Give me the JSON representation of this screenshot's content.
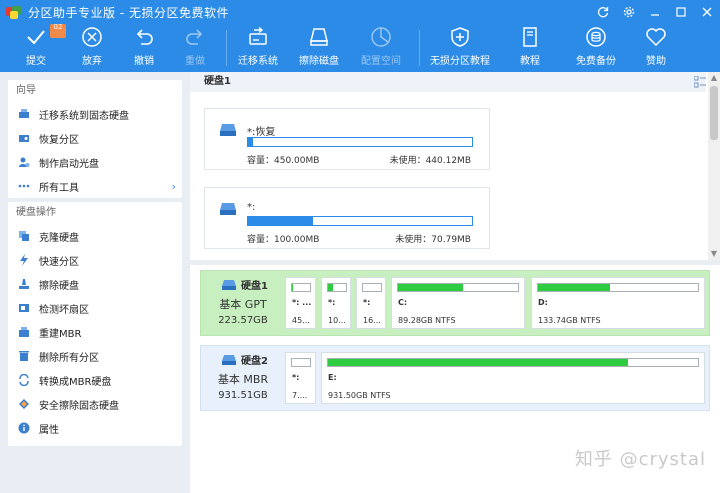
{
  "window": {
    "title": "分区助手专业版 - 无损分区免费软件"
  },
  "toolbar": {
    "submit": "提交",
    "submit_badge": "02",
    "discard": "放弃",
    "undo": "撤销",
    "redo": "重做",
    "migrate": "迁移系统",
    "wipe": "擦除磁盘",
    "alloc": "配置空间",
    "tutorial_lossless": "无损分区教程",
    "tutorial": "教程",
    "backup": "免费备份",
    "donate": "赞助"
  },
  "sidebar": {
    "wizard_title": "向导",
    "wizard_items": [
      {
        "label": "迁移系统到固态硬盘"
      },
      {
        "label": "恢复分区"
      },
      {
        "label": "制作启动光盘"
      },
      {
        "label": "所有工具"
      }
    ],
    "disk_ops_title": "硬盘操作",
    "disk_items": [
      {
        "label": "克隆硬盘"
      },
      {
        "label": "快速分区"
      },
      {
        "label": "擦除硬盘"
      },
      {
        "label": "检测坏扇区"
      },
      {
        "label": "重建MBR"
      },
      {
        "label": "删除所有分区"
      },
      {
        "label": "转换成MBR硬盘"
      },
      {
        "label": "安全擦除固态硬盘"
      },
      {
        "label": "属性"
      }
    ]
  },
  "detail": {
    "disk_title": "硬盘1",
    "partitions": [
      {
        "name": "*:恢复",
        "capacity": "容量：450.00MB",
        "free": "未使用：440.12MB",
        "used_fraction": 0.022
      },
      {
        "name": "*:",
        "capacity": "容量：100.00MB",
        "free": "未使用：70.79MB",
        "used_fraction": 0.29
      }
    ]
  },
  "disks": [
    {
      "name": "硬盘1",
      "type": "基本 GPT",
      "size": "223.57GB",
      "partitions": [
        {
          "label": "*: ...",
          "info": "45...",
          "used_fraction": 0.02
        },
        {
          "label": "*:",
          "info": "10...",
          "used_fraction": 0.3
        },
        {
          "label": "*:",
          "info": "16...",
          "used_fraction": 0.0
        },
        {
          "label": "C:",
          "info": "89.28GB NTFS",
          "used_fraction": 0.54
        },
        {
          "label": "D:",
          "info": "133.74GB NTFS",
          "used_fraction": 0.45
        }
      ]
    },
    {
      "name": "硬盘2",
      "type": "基本 MBR",
      "size": "931.51GB",
      "partitions": [
        {
          "label": "*:",
          "info": "7....",
          "used_fraction": 0.0
        },
        {
          "label": "E:",
          "info": "931.50GB NTFS",
          "used_fraction": 0.81
        }
      ]
    }
  ],
  "watermark": "知乎 @crystal",
  "colors": {
    "accent": "#2b8be6",
    "used_green": "#2ecc40",
    "selected_row": "#c8efc0"
  }
}
